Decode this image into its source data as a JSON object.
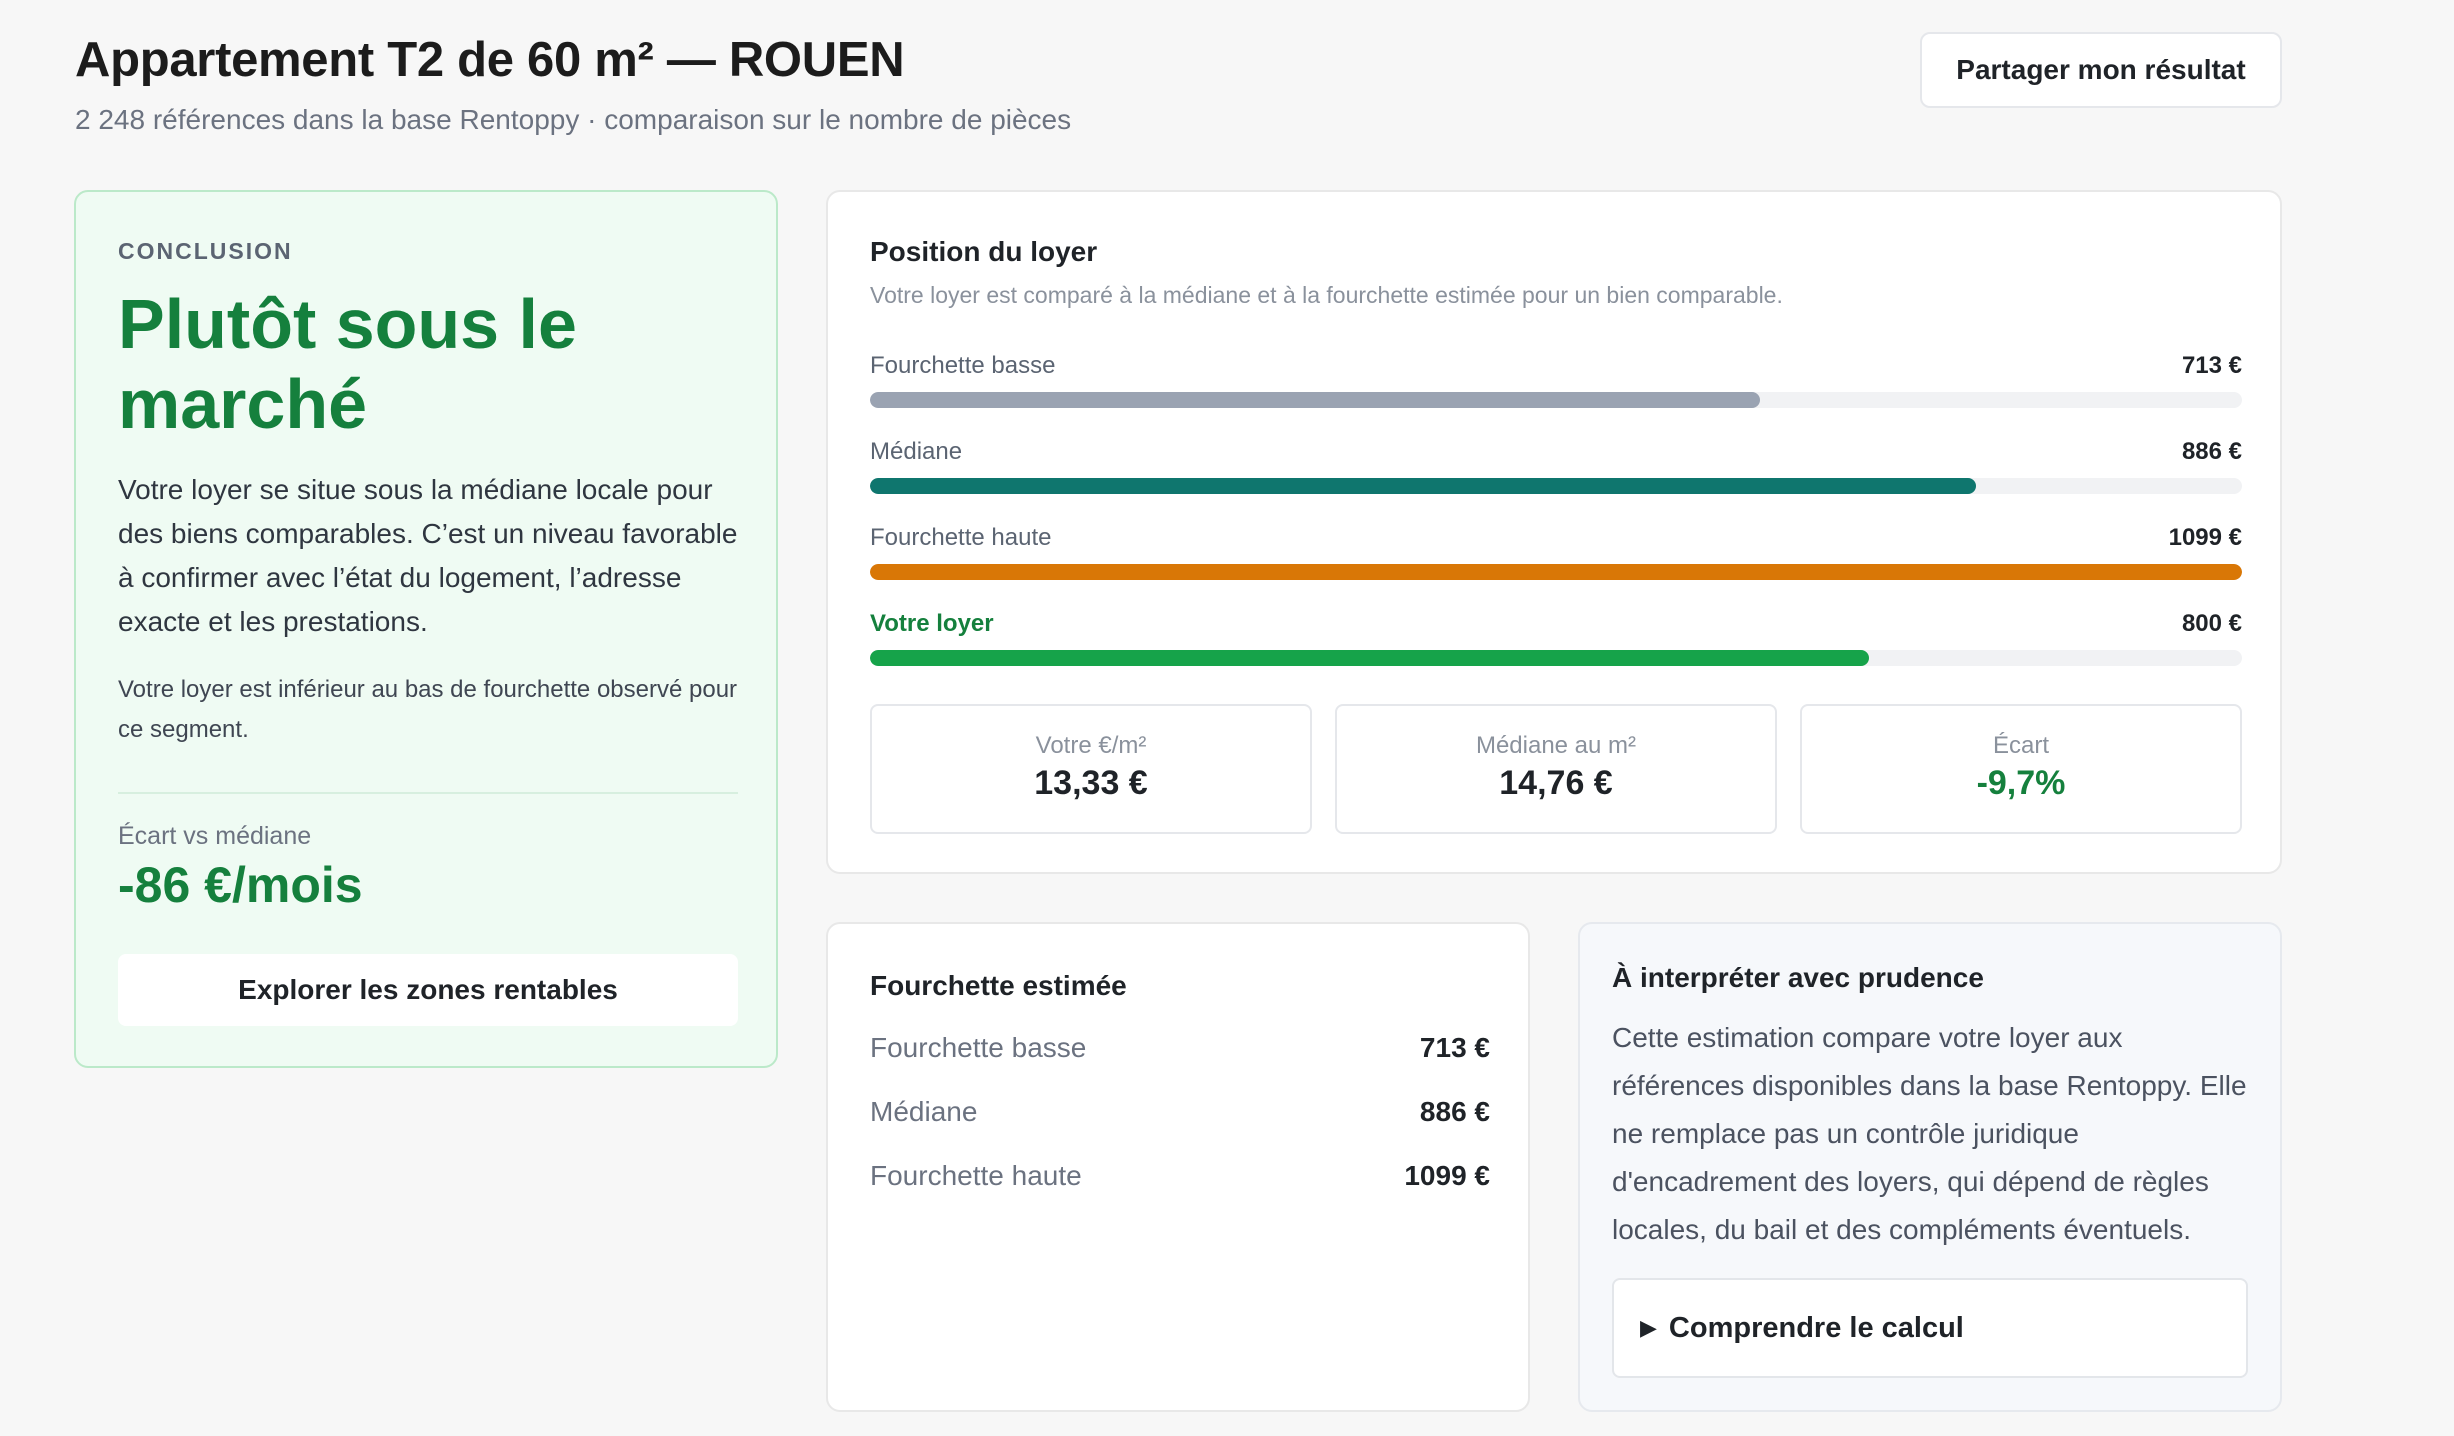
{
  "header": {
    "title": "Appartement T2 de 60 m² — ROUEN",
    "subtitle": "2 248 références dans la base Rentoppy · comparaison sur le nombre de pièces",
    "share_label": "Partager mon résultat"
  },
  "conclusion": {
    "eyebrow": "CONCLUSION",
    "headline": "Plutôt sous le marché",
    "body": "Votre loyer se situe sous la médiane locale pour des biens comparables. C’est un niveau favorable à confirmer avec l’état du logement, l’adresse exacte et les prestations.",
    "note": "Votre loyer est inférieur au bas de fourchette observé pour ce segment.",
    "gap_label": "Écart vs médiane",
    "gap_value": "-86 €/mois",
    "explore_label": "Explorer les zones rentables"
  },
  "position": {
    "title": "Position du loyer",
    "description": "Votre loyer est comparé à la médiane et à la fourchette estimée pour un bien comparable.",
    "bars": [
      {
        "label": "Fourchette basse",
        "value": "713 €",
        "amount": 713,
        "color": "#9aa3b2",
        "highlight": false
      },
      {
        "label": "Médiane",
        "value": "886 €",
        "amount": 886,
        "color": "#0f766e",
        "highlight": false
      },
      {
        "label": "Fourchette haute",
        "value": "1099 €",
        "amount": 1099,
        "color": "#d97706",
        "highlight": false
      },
      {
        "label": "Votre loyer",
        "value": "800 €",
        "amount": 800,
        "color": "#16a34a",
        "highlight": true
      }
    ],
    "scale_max": 1099,
    "stats": [
      {
        "label": "Votre €/m²",
        "value": "13,33 €"
      },
      {
        "label": "Médiane au m²",
        "value": "14,76 €"
      },
      {
        "label": "Écart",
        "value": "-9,7%"
      }
    ]
  },
  "range": {
    "title": "Fourchette estimée",
    "rows": [
      {
        "label": "Fourchette basse",
        "value": "713 €"
      },
      {
        "label": "Médiane",
        "value": "886 €"
      },
      {
        "label": "Fourchette haute",
        "value": "1099 €"
      }
    ]
  },
  "caution": {
    "title": "À interpréter avec prudence",
    "body": "Cette estimation compare votre loyer aux références disponibles dans la base Rentoppy. Elle ne remplace pas un contrôle juridique d'encadrement des loyers, qui dépend de règles locales, du bail et des compléments éventuels.",
    "toggle_icon": "triangle-right-icon",
    "toggle_label": "Comprendre le calcul"
  },
  "colors": {
    "accent_green": "#15803d",
    "median_teal": "#0f766e",
    "high_orange": "#d97706",
    "low_gray": "#9aa3b2"
  }
}
